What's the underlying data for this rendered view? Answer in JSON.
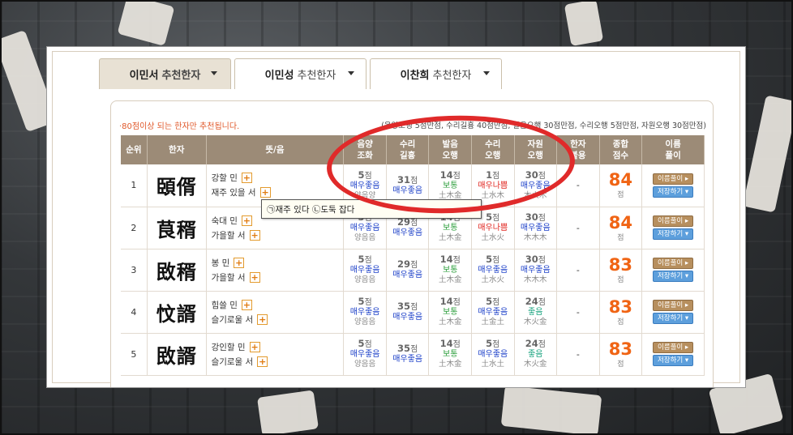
{
  "tabs": [
    {
      "name": "이민서",
      "suffix": "추천한자",
      "active": true
    },
    {
      "name": "이민성",
      "suffix": "추천한자",
      "active": false
    },
    {
      "name": "이찬희",
      "suffix": "추천한자",
      "active": false
    }
  ],
  "notice_left": "·80점이상 되는 한자만 추천됩니다.",
  "notice_right": "(음양오행 5점만점, 수리길흉 40점만점, 발음오행 30점만점, 수리오행 5점만점, 자원오행 30점만점)",
  "headers": {
    "rank": "순위",
    "hanja": "한자",
    "meaning": "뜻/음",
    "c1a": "음양",
    "c1b": "조화",
    "c2a": "수리",
    "c2b": "길흉",
    "c3a": "발음",
    "c3b": "오행",
    "c4a": "수리",
    "c4b": "오행",
    "c5a": "자원",
    "c5b": "오행",
    "c6a": "한자",
    "c6b": "불용",
    "c7a": "종합",
    "c7b": "점수",
    "c8a": "이름",
    "c8b": "풀이"
  },
  "buttons": {
    "interpret": "이름풀이 ▸",
    "save": "저장하기 ▾"
  },
  "point_unit": "점",
  "rows": [
    {
      "rank": "1",
      "hanja": "頣偦",
      "m1": "강할 민",
      "m2": "재주 있을 서",
      "s1": "5",
      "s1l": "매우좋음",
      "s1e": "양음양",
      "s2": "31",
      "s2l": "매우좋음",
      "s3": "14",
      "s3l": "보통",
      "s3e": "土木金",
      "s4": "1",
      "s4l": "매우나쁨",
      "s4e": "土水木",
      "s5": "30",
      "s5l": "매우좋음",
      "s5e": "木火木",
      "ban": "-",
      "total": "84"
    },
    {
      "rank": "2",
      "hanja": "茛稰",
      "m1": "숙대 민",
      "m2": "가을할 서",
      "s1": "5",
      "s1l": "매우좋음",
      "s1e": "양음음",
      "s2": "29",
      "s2l": "매우좋음",
      "s3": "14",
      "s3l": "보통",
      "s3e": "土木金",
      "s4": "5",
      "s4l": "매우나쁨",
      "s4e": "土水火",
      "s5": "30",
      "s5l": "매우좋음",
      "s5e": "木木木",
      "ban": "-",
      "total": "84"
    },
    {
      "rank": "3",
      "hanja": "敃稰",
      "m1": "봉 민",
      "m2": "가을할 서",
      "s1": "5",
      "s1l": "매우좋음",
      "s1e": "양음음",
      "s2": "29",
      "s2l": "매우좋음",
      "s3": "14",
      "s3l": "보통",
      "s3e": "土木金",
      "s4": "5",
      "s4l": "매우좋음",
      "s4e": "土水火",
      "s5": "30",
      "s5l": "매우좋음",
      "s5e": "木木木",
      "ban": "-",
      "total": "83"
    },
    {
      "rank": "4",
      "hanja": "忟諝",
      "m1": "힘쓸 민",
      "m2": "슬기로울 서",
      "s1": "5",
      "s1l": "매우좋음",
      "s1e": "양음음",
      "s2": "35",
      "s2l": "매우좋음",
      "s3": "14",
      "s3l": "보통",
      "s3e": "土木金",
      "s4": "5",
      "s4l": "매우좋음",
      "s4e": "土金土",
      "s5": "24",
      "s5l": "좋음",
      "s5e": "木火金",
      "ban": "-",
      "total": "83"
    },
    {
      "rank": "5",
      "hanja": "敃諝",
      "m1": "강인할 민",
      "m2": "슬기로울 서",
      "s1": "5",
      "s1l": "매우좋음",
      "s1e": "양음음",
      "s2": "35",
      "s2l": "매우좋음",
      "s3": "14",
      "s3l": "보통",
      "s3e": "土木金",
      "s4": "5",
      "s4l": "매우좋음",
      "s4e": "土水土",
      "s5": "24",
      "s5l": "좋음",
      "s5e": "木火金",
      "ban": "-",
      "total": "83"
    }
  ],
  "tooltip": "㉠재주 있다 ㉡도둑 잡다",
  "colors": {
    "header_bg": "#9c8b77",
    "score_total": "#f06414",
    "good": "#1b3fc8",
    "bad": "#e0241e",
    "normal": "#2a9d3a",
    "oval": "#e02a2a"
  }
}
